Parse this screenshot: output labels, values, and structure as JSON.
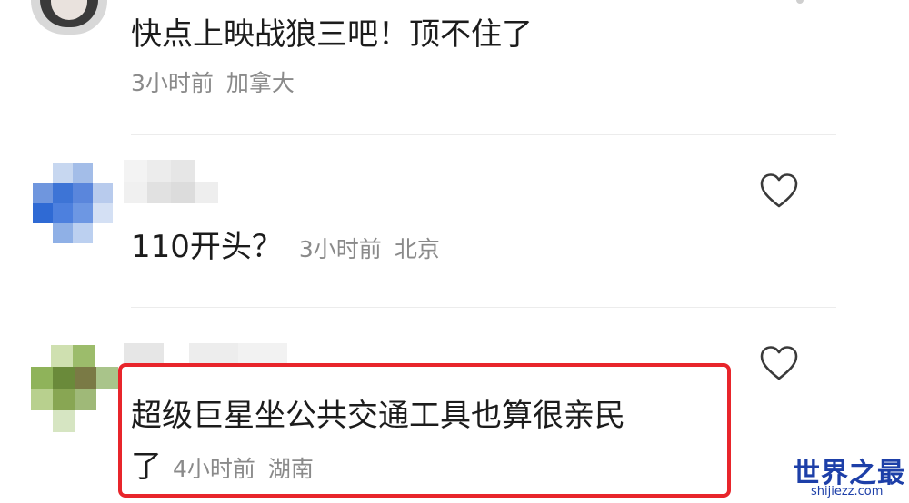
{
  "comments": [
    {
      "text": "快点上映战狼三吧！顶不住了",
      "time": "3小时前",
      "location": "加拿大"
    },
    {
      "text": "110开头？",
      "time": "3小时前",
      "location": "北京"
    },
    {
      "text_line1": "超级巨星坐公共交通工具也算很亲民",
      "text_line2": "了",
      "time": "4小时前",
      "location": "湖南"
    }
  ],
  "icons": {
    "like": "heart-outline-icon"
  },
  "colors": {
    "highlight": "#e8252b",
    "meta": "#8a8a8a",
    "watermark": "#1d3fa8"
  },
  "watermark": {
    "main": "世界之最",
    "sub": "shijiezz.com"
  }
}
